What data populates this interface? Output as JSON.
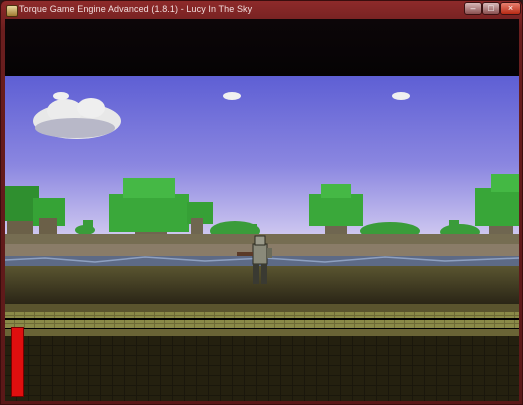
{
  "window": {
    "title": "Torque Game Engine Advanced (1.8.1) - Lucy In The Sky",
    "buttons": {
      "minimize": "–",
      "maximize": "□",
      "close": "×"
    }
  },
  "game": {
    "hud": {
      "health_fraction": 1.0
    },
    "colors": {
      "sky_top": "#5e5fd4",
      "sky_bottom": "#cfc8f0",
      "tree_foliage": "#3fae3f",
      "ground_dark": "#2a2516",
      "health": "#e00f0f"
    }
  }
}
